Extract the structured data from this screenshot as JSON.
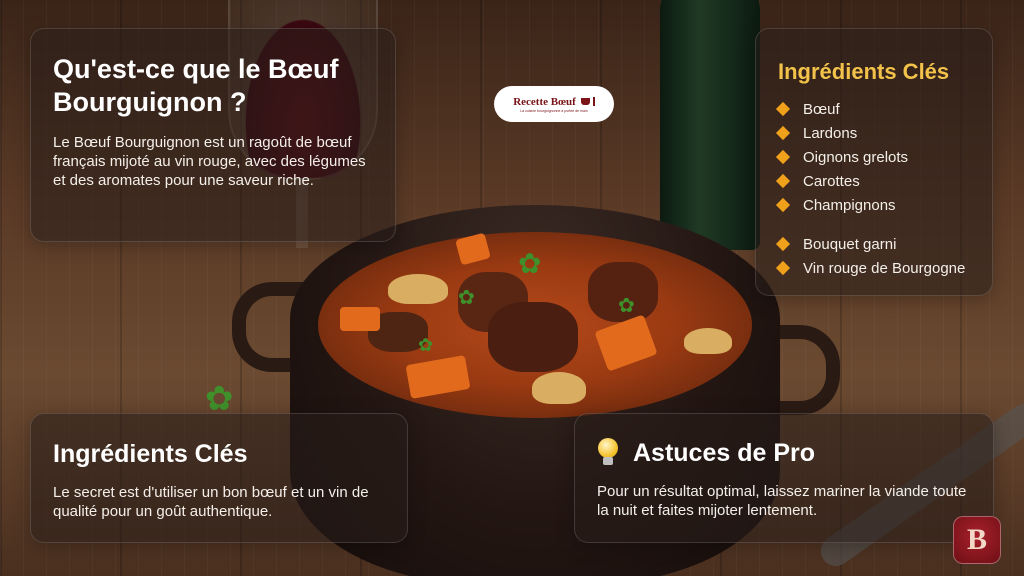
{
  "logo": {
    "name": "Recette Bœuf",
    "tagline": "La cuisine bourguignonne à portée de main",
    "badge": "B"
  },
  "intro": {
    "title": "Qu'est-ce que le Bœuf Bourguignon ?",
    "text": "Le Bœuf Bourguignon est un ragoût de bœuf français mijoté au vin rouge, avec des légumes et des aromates pour une saveur riche."
  },
  "ingredients": {
    "title": "Ingrédients Clés",
    "items": [
      "Bœuf",
      "Lardons",
      "Oignons grelots",
      "Carottes",
      "Champignons",
      "Bouquet garni",
      "Vin rouge de Bourgogne"
    ]
  },
  "secret": {
    "title": "Ingrédients Clés",
    "text": "Le secret est d'utiliser un bon bœuf et un vin de qualité pour un goût authentique."
  },
  "tips": {
    "title": "Astuces de Pro",
    "text": "Pour un résultat optimal, laissez mariner la viande toute la nuit et faites mijoter lentement."
  },
  "colors": {
    "accent_gold": "#f2c24a",
    "bullet_orange": "#f0a11c",
    "logo_red": "#7a1418"
  }
}
